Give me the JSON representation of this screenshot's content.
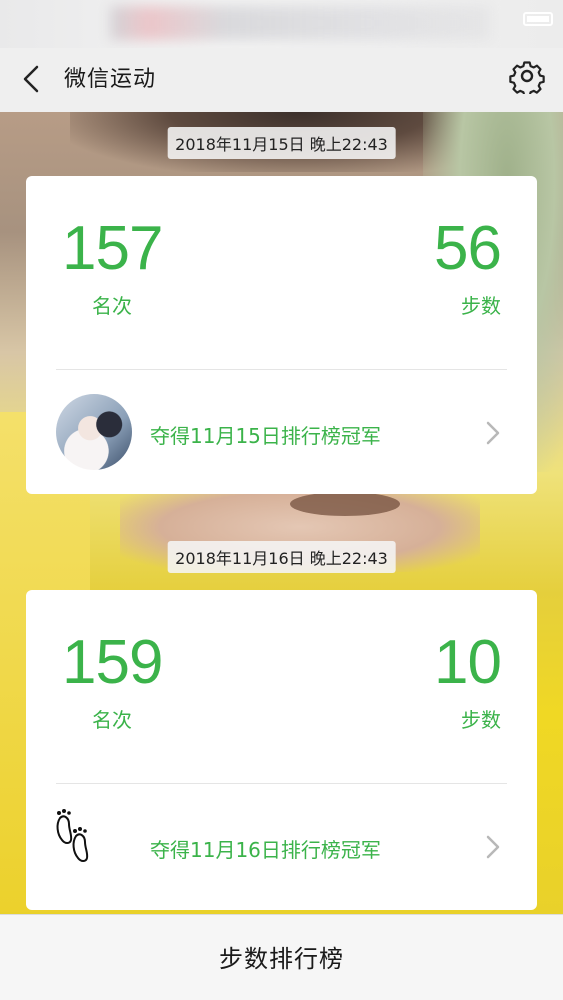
{
  "nav": {
    "title": "微信运动"
  },
  "entries": [
    {
      "timestamp": "2018年11月15日 晚上22:43",
      "rank": "157",
      "rank_label": "名次",
      "steps": "56",
      "steps_label": "步数",
      "champion_text": "夺得11月15日排行榜冠军",
      "icon": "avatar-photo"
    },
    {
      "timestamp": "2018年11月16日 晚上22:43",
      "rank": "159",
      "rank_label": "名次",
      "steps": "10",
      "steps_label": "步数",
      "champion_text": "夺得11月16日排行榜冠军",
      "icon": "footprint-icon"
    }
  ],
  "bottom": {
    "label": "步数排行榜"
  },
  "colors": {
    "accent_green": "#3bb34a",
    "card_bg": "#ffffff",
    "nav_bg": "#efefef"
  }
}
